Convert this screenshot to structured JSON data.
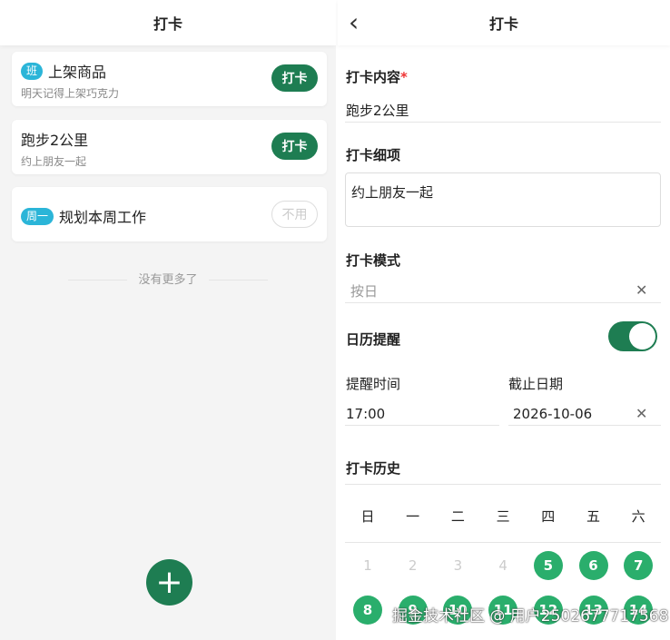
{
  "left": {
    "title": "打卡",
    "items": [
      {
        "tag": "班",
        "title": "上架商品",
        "sub": "明天记得上架巧克力",
        "button": "打卡"
      },
      {
        "title": "跑步2公里",
        "sub": "约上朋友一起",
        "button": "打卡"
      },
      {
        "tag": "周一",
        "title": "规划本周工作",
        "button": "不用"
      }
    ],
    "no_more": "没有更多了",
    "fab": "+"
  },
  "right": {
    "title": "打卡",
    "back": "‹",
    "content_label": "打卡内容",
    "required": "*",
    "content_value": "跑步2公里",
    "detail_label": "打卡细项",
    "detail_value": "约上朋友一起",
    "mode_label": "打卡模式",
    "mode_placeholder": "按日",
    "reminder_label": "日历提醒",
    "reminder_on": true,
    "time_label": "提醒时间",
    "time_value": "17:00",
    "end_label": "截止日期",
    "end_value": "2026-10-06",
    "history_label": "打卡历史",
    "weekdays": [
      "日",
      "一",
      "二",
      "三",
      "四",
      "五",
      "六"
    ],
    "days": [
      {
        "d": "1",
        "on": false
      },
      {
        "d": "2",
        "on": false
      },
      {
        "d": "3",
        "on": false
      },
      {
        "d": "4",
        "on": false
      },
      {
        "d": "5",
        "on": true
      },
      {
        "d": "6",
        "on": true
      },
      {
        "d": "7",
        "on": true
      },
      {
        "d": "8",
        "on": true
      },
      {
        "d": "9",
        "on": true
      },
      {
        "d": "10",
        "on": true
      },
      {
        "d": "11",
        "on": true
      },
      {
        "d": "12",
        "on": true
      },
      {
        "d": "13",
        "on": true
      },
      {
        "d": "14",
        "on": true
      }
    ]
  },
  "watermark": "掘金技术社区 @ 用户2502677717568"
}
